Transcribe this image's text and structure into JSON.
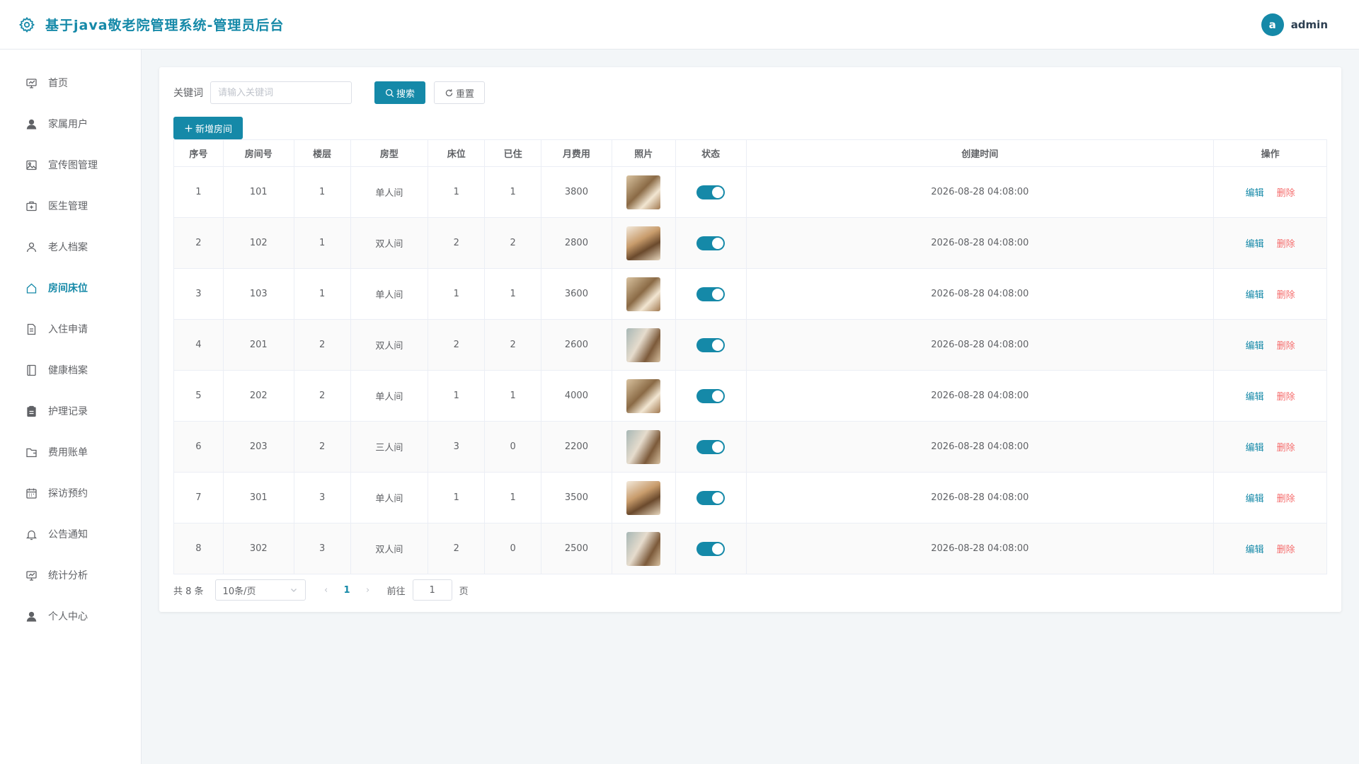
{
  "header": {
    "title": "基于java敬老院管理系统-管理员后台",
    "avatar_letter": "a",
    "username": "admin"
  },
  "sidebar": {
    "items": [
      {
        "label": "首页",
        "icon": "home-chart-icon"
      },
      {
        "label": "家属用户",
        "icon": "user-icon"
      },
      {
        "label": "宣传图管理",
        "icon": "picture-icon"
      },
      {
        "label": "医生管理",
        "icon": "medical-box-icon"
      },
      {
        "label": "老人档案",
        "icon": "person-icon"
      },
      {
        "label": "房间床位",
        "icon": "house-icon",
        "active": true
      },
      {
        "label": "入住申请",
        "icon": "document-icon"
      },
      {
        "label": "健康档案",
        "icon": "notebook-icon"
      },
      {
        "label": "护理记录",
        "icon": "clipboard-icon"
      },
      {
        "label": "费用账单",
        "icon": "wallet-icon"
      },
      {
        "label": "探访预约",
        "icon": "calendar-icon"
      },
      {
        "label": "公告通知",
        "icon": "bell-icon"
      },
      {
        "label": "统计分析",
        "icon": "chart-icon"
      },
      {
        "label": "个人中心",
        "icon": "user-icon"
      }
    ]
  },
  "search": {
    "label": "关键词",
    "placeholder": "请输入关键词",
    "search_btn": "搜索",
    "reset_btn": "重置"
  },
  "add_btn": "新增房间",
  "table": {
    "columns": [
      "序号",
      "房间号",
      "楼层",
      "房型",
      "床位",
      "已住",
      "月费用",
      "照片",
      "状态",
      "创建时间",
      "操作"
    ],
    "rows": [
      {
        "idx": "1",
        "room": "101",
        "floor": "1",
        "type": "单人间",
        "beds": "1",
        "occupied": "1",
        "fee": "3800",
        "status": true,
        "created": "2026-08-28 04:08:00"
      },
      {
        "idx": "2",
        "room": "102",
        "floor": "1",
        "type": "双人间",
        "beds": "2",
        "occupied": "2",
        "fee": "2800",
        "status": true,
        "created": "2026-08-28 04:08:00"
      },
      {
        "idx": "3",
        "room": "103",
        "floor": "1",
        "type": "单人间",
        "beds": "1",
        "occupied": "1",
        "fee": "3600",
        "status": true,
        "created": "2026-08-28 04:08:00"
      },
      {
        "idx": "4",
        "room": "201",
        "floor": "2",
        "type": "双人间",
        "beds": "2",
        "occupied": "2",
        "fee": "2600",
        "status": true,
        "created": "2026-08-28 04:08:00"
      },
      {
        "idx": "5",
        "room": "202",
        "floor": "2",
        "type": "单人间",
        "beds": "1",
        "occupied": "1",
        "fee": "4000",
        "status": true,
        "created": "2026-08-28 04:08:00"
      },
      {
        "idx": "6",
        "room": "203",
        "floor": "2",
        "type": "三人间",
        "beds": "3",
        "occupied": "0",
        "fee": "2200",
        "status": true,
        "created": "2026-08-28 04:08:00"
      },
      {
        "idx": "7",
        "room": "301",
        "floor": "3",
        "type": "单人间",
        "beds": "1",
        "occupied": "1",
        "fee": "3500",
        "status": true,
        "created": "2026-08-28 04:08:00"
      },
      {
        "idx": "8",
        "room": "302",
        "floor": "3",
        "type": "双人间",
        "beds": "2",
        "occupied": "0",
        "fee": "2500",
        "status": true,
        "created": "2026-08-28 04:08:00"
      }
    ],
    "edit_label": "编辑",
    "delete_label": "删除"
  },
  "pagination": {
    "total_text": "共 8 条",
    "page_size": "10条/页",
    "current_page": "1",
    "jump_prefix": "前往",
    "jump_value": "1",
    "jump_suffix": "页"
  },
  "colors": {
    "primary": "#1589a8",
    "danger": "#f56c6c",
    "background": "#f3f6f8"
  }
}
